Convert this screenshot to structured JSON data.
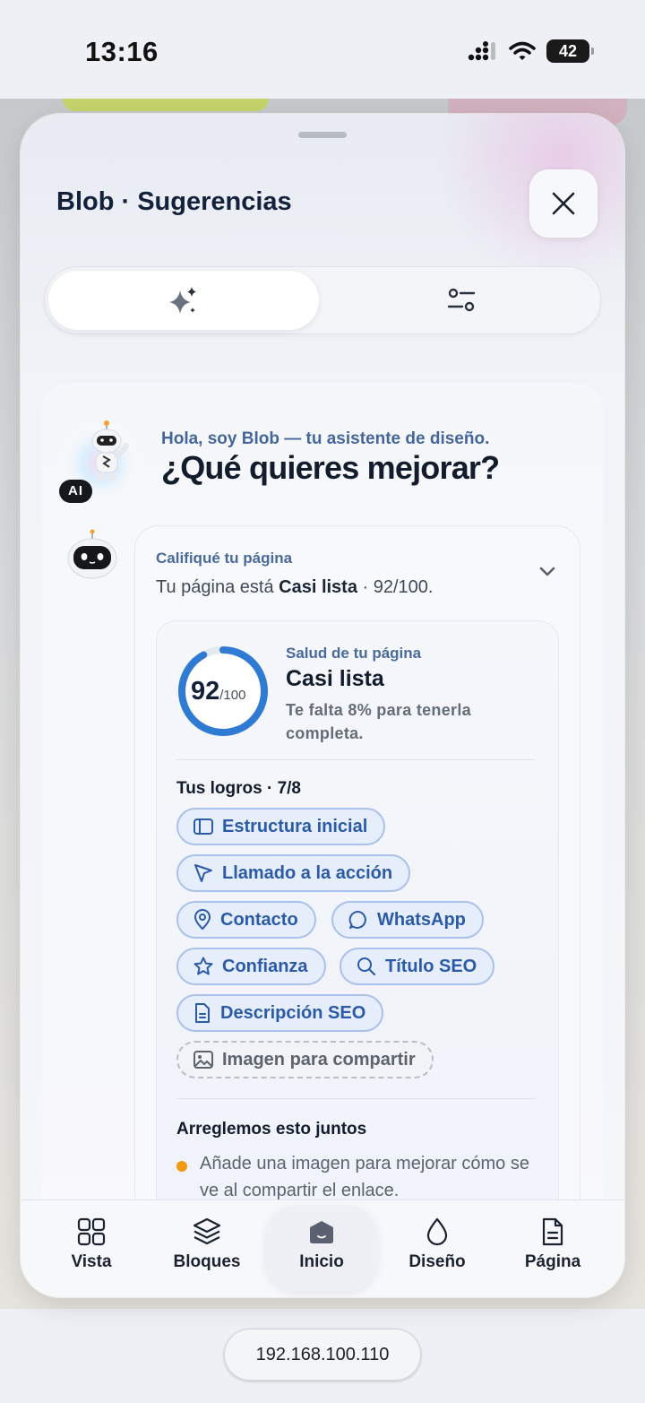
{
  "status_bar": {
    "time": "13:16",
    "battery": "42"
  },
  "sheet": {
    "title": "Blob · Sugerencias",
    "tabs": [
      {
        "icon": "sparkles-icon"
      },
      {
        "icon": "sliders-icon"
      }
    ]
  },
  "assistant": {
    "badge": "AI",
    "greeting": "Hola, soy Blob — tu asistente de diseño.",
    "question": "¿Qué quieres mejorar?"
  },
  "message": {
    "label": "Califiqué tu página",
    "text_prefix": "Tu página está ",
    "text_bold": "Casi lista",
    "text_suffix": " · 92/100."
  },
  "health": {
    "score": "92",
    "score_max": "/100",
    "score_fraction": 0.92,
    "label": "Salud de tu página",
    "title": "Casi lista",
    "subtitle": "Te falta 8% para tenerla completa.",
    "achievements_heading": "Tus logros · 7/8",
    "achievements": [
      {
        "label": "Estructura inicial",
        "icon": "layout-icon",
        "done": true
      },
      {
        "label": "Llamado a la acción",
        "icon": "cursor-icon",
        "done": true
      },
      {
        "label": "Contacto",
        "icon": "location-pin-icon",
        "done": true
      },
      {
        "label": "WhatsApp",
        "icon": "chat-bubble-icon",
        "done": true
      },
      {
        "label": "Confianza",
        "icon": "star-icon",
        "done": true
      },
      {
        "label": "Título SEO",
        "icon": "search-icon",
        "done": true
      },
      {
        "label": "Descripción SEO",
        "icon": "document-icon",
        "done": true
      },
      {
        "label": "Imagen para compartir",
        "icon": "image-icon",
        "done": false
      }
    ],
    "fix_heading": "Arreglemos esto juntos",
    "fix_item": "Añade una imagen para mejorar cómo se ve al compartir el enlace."
  },
  "bottom_nav": [
    {
      "label": "Vista",
      "icon": "grid-icon"
    },
    {
      "label": "Bloques",
      "icon": "layers-icon"
    },
    {
      "label": "Inicio",
      "icon": "blob-home-icon",
      "active": true
    },
    {
      "label": "Diseño",
      "icon": "drop-icon"
    },
    {
      "label": "Página",
      "icon": "page-icon"
    }
  ],
  "browser": {
    "url": "192.168.100.110"
  },
  "colors": {
    "accent": "#2b5aa6",
    "ring": "#2f7bd3",
    "warning": "#f19a12"
  }
}
